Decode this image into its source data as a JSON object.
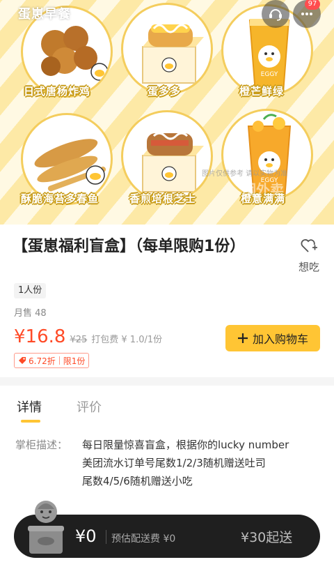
{
  "header": {
    "shop_name": "蛋崽早餐",
    "service_icon": "customer-service-icon",
    "more_icon": "more-dots-icon",
    "badge_count": "97"
  },
  "hero": {
    "products": [
      {
        "name": "日式唐杨炸鸡"
      },
      {
        "name": "蛋多多"
      },
      {
        "name": "橙芒鲜绿"
      },
      {
        "name": "酥脆海苔多春鱼"
      },
      {
        "name": "香煎培根芝士"
      },
      {
        "name": "橙意满满"
      }
    ],
    "watermark_small": "图片仅供参考 请以实物为准",
    "watermark_large": "团外卖"
  },
  "product": {
    "title": "【蛋崽福利盲盒】（每单限购1份）",
    "favorite_label": "想吃",
    "portion": "1人份",
    "monthly_sales": "月售 48",
    "price": "¥16.8",
    "original_price": "¥25",
    "packing_fee": "打包费 ¥ 1.0/1份",
    "add_to_cart_label": "加入购物车",
    "discount_rate": "6.72折",
    "limit": "限1份"
  },
  "tabs": [
    {
      "label": "详情",
      "active": true
    },
    {
      "label": "评价",
      "active": false
    }
  ],
  "details": {
    "label": "掌柜描述：",
    "lines": [
      "每日限量惊喜盲盒，根据你的lucky number",
      "美团流水订单号尾数1/2/3随机赠送吐司",
      "尾数4/5/6随机赠送小吃"
    ]
  },
  "cart_bar": {
    "total": "¥0",
    "delivery_fee": "预估配送费 ¥0",
    "min_order": "¥30起送"
  },
  "colors": {
    "accent": "#ffc534",
    "price": "#ff4a26",
    "bar_bg": "#1f1f1f",
    "stripe": "#fde9a6"
  }
}
